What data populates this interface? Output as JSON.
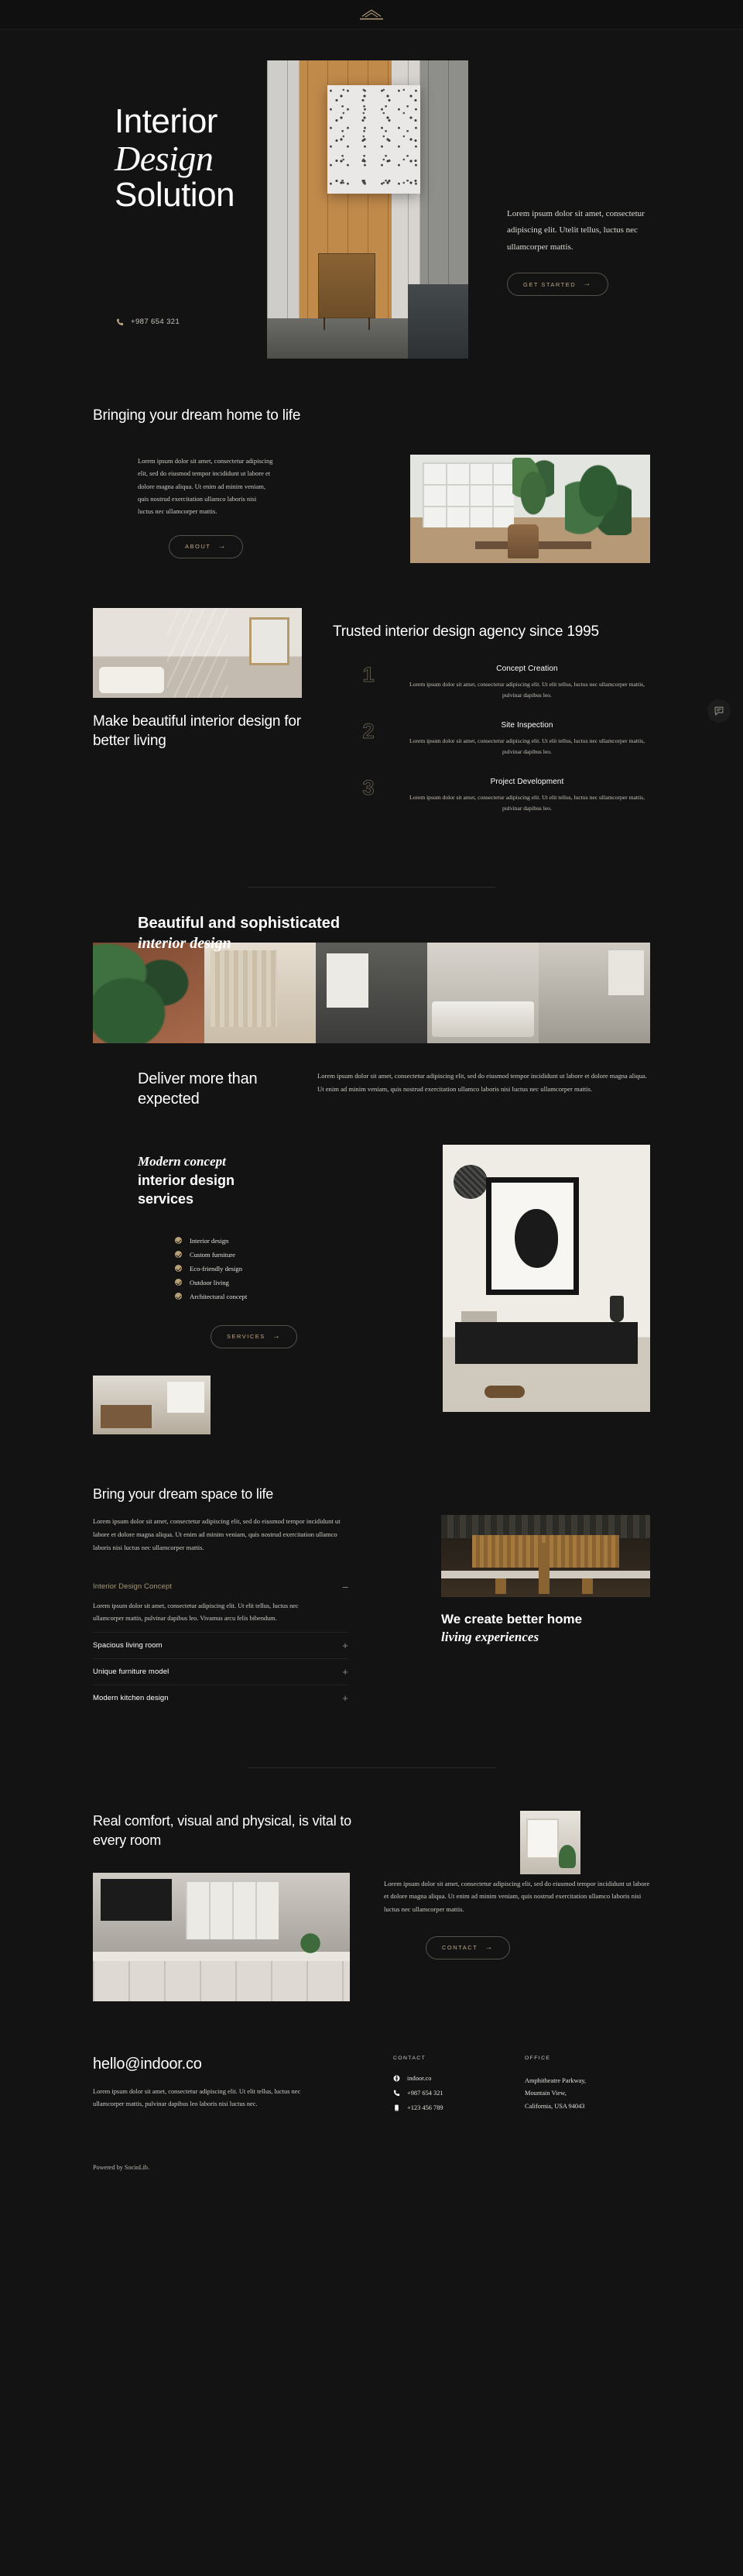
{
  "header": {
    "logo_name": "house-roof-logo"
  },
  "hero": {
    "title_line1": "Interior",
    "title_line2": "Design",
    "title_line3": "Solution",
    "phone": "+987 654 321",
    "paragraph": "Lorem ipsum dolor sit amet, consectetur adipiscing elit. Utelit tellus, luctus nec ullamcorper mattis.",
    "cta": "GET STARTED"
  },
  "section_dream": {
    "heading": "Bringing your dream home to life",
    "paragraph": "Lorem ipsum dolor sit amet, consectetur adipiscing elit, sed do eiusmod tempor incididunt ut labore et dolore magna aliqua. Ut enim ad minim veniam, quis nostrud exercitation ullamco laboris nisi luctus nec ullamcorper mattis.",
    "cta": "ABOUT"
  },
  "section_trusted": {
    "heading": "Trusted interior design agency since 1995",
    "left_heading": "Make beautiful interior design for better living",
    "steps": [
      {
        "num": "1",
        "title": "Concept Creation",
        "text": "Lorem ipsum dolor sit amet, consectetur adipiscing elit. Ut elit tellus, luctus nec ullamcorper mattis, pulvinar dapibus leo."
      },
      {
        "num": "2",
        "title": "Site Inspection",
        "text": "Lorem ipsum dolor sit amet, consectetur adipiscing elit. Ut elit tellus, luctus nec ullamcorper mattis, pulvinar dapibus leo."
      },
      {
        "num": "3",
        "title": "Project Development",
        "text": "Lorem ipsum dolor sit amet, consectetur adipiscing elit. Ut elit tellus, luctus nec ullamcorper mattis, pulvinar dapibus leo."
      }
    ]
  },
  "section_beautiful": {
    "heading_line1": "Beautiful and sophisticated",
    "heading_line2": "interior design",
    "subheading": "Deliver more than expected",
    "paragraph": "Lorem ipsum dolor sit amet, consectetur adipiscing elit, sed do eiusmod tempor incididunt ut labore et dolore magna aliqua. Ut enim ad minim veniam, quis nostrud exercitation ullamco laboris nisi luctus nec ullamcorper mattis."
  },
  "section_services": {
    "heading_line1": "Modern concept",
    "heading_line2": "interior design",
    "heading_line3": "services",
    "items": [
      "Interior design",
      "Custom furniture",
      "Eco-friendly design",
      "Outdoor living",
      "Architectural concept"
    ],
    "cta": "SERVICES"
  },
  "section_space": {
    "heading": "Bring your dream space to life",
    "paragraph": "Lorem ipsum dolor sit amet, consectetur adipiscing elit, sed do eiusmod tempor incididunt ut labore et dolore magna aliqua. Ut enim ad minim veniam, quis nostrud exercitation ullamco laboris nisi luctus nec ullamcorper mattis.",
    "accordion": [
      {
        "title": "Interior Design Concept",
        "sign": "–",
        "open": true,
        "body": "Lorem ipsum dolor sit amet, consectetur adipiscing elit. Ut elit tellus, luctus nec ullamcorper mattis, pulvinar dapibus leo. Vivamus arcu felis bibendum."
      },
      {
        "title": "Spacious living room",
        "sign": "+",
        "open": false,
        "body": ""
      },
      {
        "title": "Unique furniture model",
        "sign": "+",
        "open": false,
        "body": ""
      },
      {
        "title": "Modern kitchen design",
        "sign": "+",
        "open": false,
        "body": ""
      }
    ],
    "side_heading_line1": "We create better home",
    "side_heading_line2": "living experiences"
  },
  "section_comfort": {
    "heading": "Real comfort, visual and physical, is vital to every room",
    "paragraph": "Lorem ipsum dolor sit amet, consectetur adipiscing elit, sed do eiusmod tempor incididunt ut labore et dolore magna aliqua. Ut enim ad minim veniam, quis nostrud exercitation ullamco laboris nisi luctus nec ullamcorper mattis.",
    "cta": "CONTACT"
  },
  "footer": {
    "email": "hello@indoor.co",
    "description": "Lorem ipsum dolor sit amet, consectetur adipiscing elit. Ut elit tellus, luctus nec ullamcorper mattis, pulvinar dapibus leo laboris nisi luctus nec.",
    "contact_label": "CONTACT",
    "office_label": "OFFICE",
    "website": "indoor.co",
    "phone": "+987 654 321",
    "mobile": "+123 456 789",
    "address_line1": "Amphitheatre Parkway,",
    "address_line2": "Mountain View,",
    "address_line3": "California, USA 94043",
    "powered": "Powered by SocioLib."
  },
  "chat": {
    "name": "chat-bubble-icon"
  },
  "colors": {
    "background": "#131313",
    "accent": "#bda785",
    "text": "#ffffff",
    "muted": "#cfccc6"
  }
}
